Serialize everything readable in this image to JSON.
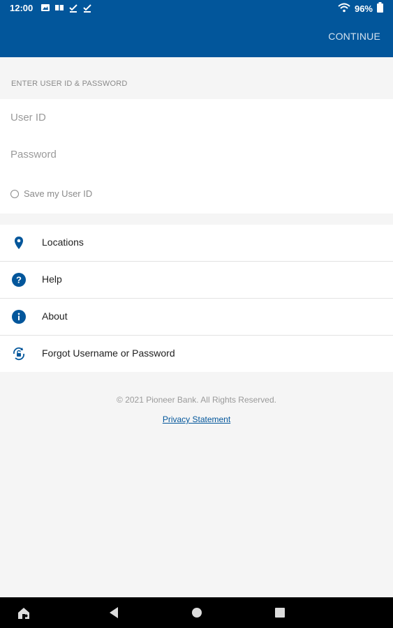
{
  "status_bar": {
    "time": "12:00",
    "battery": "96%"
  },
  "app_bar": {
    "continue_label": "CONTINUE"
  },
  "login": {
    "section_label": "ENTER USER ID & PASSWORD",
    "user_id_placeholder": "User ID",
    "password_placeholder": "Password",
    "save_user_label": "Save my User ID"
  },
  "menu": {
    "items": [
      {
        "label": "Locations",
        "icon": "location-pin-icon"
      },
      {
        "label": "Help",
        "icon": "help-icon"
      },
      {
        "label": "About",
        "icon": "info-icon"
      },
      {
        "label": "Forgot Username or Password",
        "icon": "unlock-refresh-icon"
      }
    ]
  },
  "footer": {
    "copyright": "© 2021 Pioneer Bank. All Rights Reserved.",
    "privacy_link": "Privacy Statement"
  },
  "colors": {
    "brand": "#02569b",
    "background": "#f5f5f5"
  }
}
